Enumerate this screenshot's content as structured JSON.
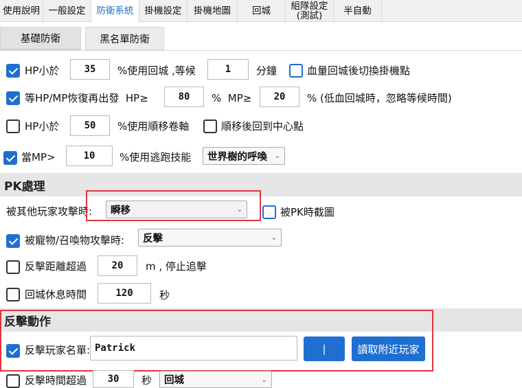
{
  "tabs": [
    {
      "label": "使用說明"
    },
    {
      "label": "一般設定"
    },
    {
      "label": "防衛系統"
    },
    {
      "label": "掛機設定"
    },
    {
      "label": "掛機地圖"
    },
    {
      "label": "回城"
    },
    {
      "label": "組隊設定\n(測試)"
    },
    {
      "label": "半自動"
    }
  ],
  "subtabs": [
    {
      "label": "基礎防衛"
    },
    {
      "label": "黑名單防衛"
    }
  ],
  "hp_low": {
    "label": "HP小於",
    "value": "35",
    "suffix": "%使用回城 ,等候",
    "wait": "1",
    "wait_unit": "分鐘",
    "switch_label": "血量回城後切換掛機點"
  },
  "recover": {
    "label": "等HP/MP恢復再出發  HP≥",
    "hp": "80",
    "mid": "%  MP≥",
    "mp": "20",
    "suffix": "% (低血回城時，忽略等候時間)"
  },
  "hp_scroll": {
    "label": "HP小於",
    "value": "50",
    "suffix": "%使用順移卷軸",
    "center_label": "順移後回到中心點"
  },
  "mp_escape": {
    "label": "當MP>",
    "value": "10",
    "suffix": "%使用逃跑技能",
    "skill": "世界樹的呼喚"
  },
  "pk_section": {
    "title": "PK處理"
  },
  "pk": {
    "attacked_label": "被其他玩家攻擊時:",
    "attacked_action": "瞬移",
    "screenshot_label": "被PK時截圖",
    "pet_label": "被寵物/召喚物攻擊時:",
    "pet_action": "反擊",
    "distance_label": "反擊距離超過",
    "distance": "20",
    "distance_suffix": "m , 停止追擊",
    "rest_label": "回城休息時間",
    "rest": "120",
    "rest_unit": "秒"
  },
  "counter_section": {
    "title": "反擊動作"
  },
  "counter": {
    "name_label": "反擊玩家名單:",
    "name_value": "Patrick",
    "pipe_label": "|",
    "nearby_button": "讀取附近玩家",
    "time_label": "反擊時間超過",
    "time_value": "30",
    "time_unit": "秒",
    "time_action": "回城"
  },
  "colors": {
    "accent": "#1f6fd1",
    "highlight": "#e0353b"
  }
}
